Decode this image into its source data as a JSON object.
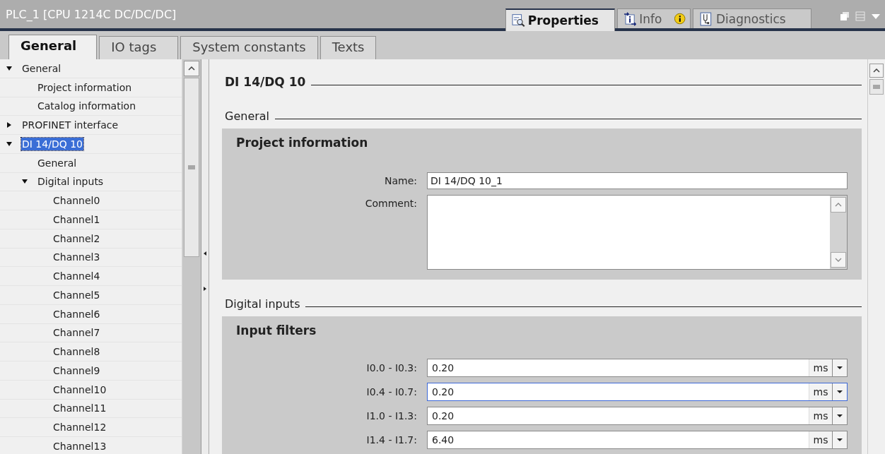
{
  "window": {
    "title": "PLC_1 [CPU 1214C DC/DC/DC]"
  },
  "view_tabs": [
    {
      "label": "Properties",
      "selected": true,
      "kind": "properties"
    },
    {
      "label": "Info",
      "selected": false,
      "kind": "info",
      "badge": true
    },
    {
      "label": "Diagnostics",
      "selected": false,
      "kind": "diagnostics"
    }
  ],
  "tabs": [
    {
      "label": "General",
      "selected": true
    },
    {
      "label": "IO tags",
      "selected": false
    },
    {
      "label": "System constants",
      "selected": false
    },
    {
      "label": "Texts",
      "selected": false
    }
  ],
  "tree": [
    {
      "label": "General",
      "expanded": true,
      "selected": false,
      "children": [
        {
          "label": "Project information",
          "selected": false
        },
        {
          "label": "Catalog information",
          "selected": false
        }
      ]
    },
    {
      "label": "PROFINET interface",
      "expanded": false,
      "selected": false
    },
    {
      "label": "DI 14/DQ 10",
      "expanded": true,
      "selected": true,
      "children": [
        {
          "label": "General",
          "selected": false
        },
        {
          "label": "Digital inputs",
          "expanded": true,
          "selected": false,
          "children": [
            {
              "label": "Channel0",
              "selected": false
            },
            {
              "label": "Channel1",
              "selected": false
            },
            {
              "label": "Channel2",
              "selected": false
            },
            {
              "label": "Channel3",
              "selected": false
            },
            {
              "label": "Channel4",
              "selected": false
            },
            {
              "label": "Channel5",
              "selected": false
            },
            {
              "label": "Channel6",
              "selected": false
            },
            {
              "label": "Channel7",
              "selected": false
            },
            {
              "label": "Channel8",
              "selected": false
            },
            {
              "label": "Channel9",
              "selected": false
            },
            {
              "label": "Channel10",
              "selected": false
            },
            {
              "label": "Channel11",
              "selected": false
            },
            {
              "label": "Channel12",
              "selected": false
            },
            {
              "label": "Channel13",
              "selected": false
            }
          ]
        }
      ]
    }
  ],
  "content": {
    "heading": "DI 14/DQ 10",
    "general": {
      "section": "General",
      "panel_title": "Project information",
      "name_label": "Name:",
      "name_value": "DI 14/DQ 10_1",
      "comment_label": "Comment:"
    },
    "digital_inputs": {
      "section": "Digital inputs",
      "panel_title": "Input filters",
      "filters": [
        {
          "label": "I0.0 - I0.3:",
          "value": "0.20",
          "unit": "ms",
          "focused": false
        },
        {
          "label": "I0.4 - I0.7:",
          "value": "0.20",
          "unit": "ms",
          "focused": true
        },
        {
          "label": "I1.0 - I1.3:",
          "value": "0.20",
          "unit": "ms",
          "focused": false
        },
        {
          "label": "I1.4 - I1.7:",
          "value": "6.40",
          "unit": "ms",
          "focused": false
        }
      ]
    }
  }
}
